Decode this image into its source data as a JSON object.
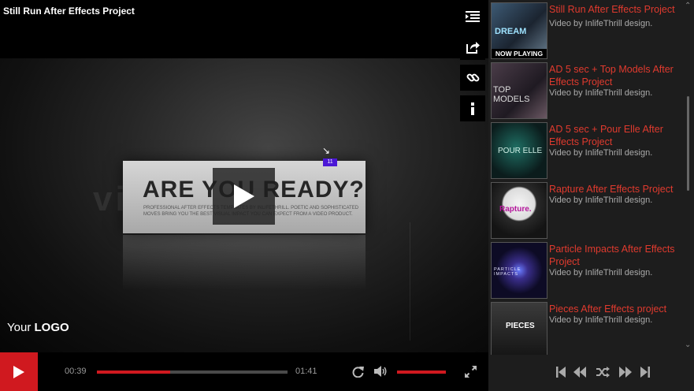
{
  "video": {
    "title": "Still Run After Effects Project",
    "logo_prefix": "Your",
    "logo_bold": "LOGO",
    "scene_heading": "ARE YOU READY?",
    "scene_subtext": "PROFESSIONAL AFTER EFFECTS TEMPLATES BY INLIFETHRILL. POETIC AND SOPHISTICATED MOVES BRING YOU THE BEST VISUAL IMPACT YOU CAN EXPECT FROM A VIDEO PRODUCT.",
    "scene_badge": "11"
  },
  "side_tools": [
    {
      "icon": "playlist-icon"
    },
    {
      "icon": "share-icon"
    },
    {
      "icon": "link-icon"
    },
    {
      "icon": "info-icon"
    }
  ],
  "controls": {
    "current_time": "00:39",
    "duration": "01:41",
    "progress": 0.385,
    "volume": 1.0
  },
  "playlist": {
    "items": [
      {
        "title": "Still Run After Effects Project",
        "author": "Video by InlifeThrill design.",
        "now_playing": "NOW PLAYING",
        "thumb_text": "DREAM"
      },
      {
        "title": "AD 5 sec + Top Models After Effects Project",
        "author": "Video by InlifeThrill design.",
        "thumb_text": "TOP MODELS"
      },
      {
        "title": "AD 5 sec + Pour Elle After Effects Project",
        "author": "Video by InlifeThrill design.",
        "thumb_text": "POUR ELLE"
      },
      {
        "title": "Rapture After Effects Project",
        "author": "Video by InlifeThrill design.",
        "thumb_text": "Rapture."
      },
      {
        "title": "Particle Impacts After Effects Project",
        "author": "Video by InlifeThrill design.",
        "thumb_text": "PARTICLE IMPACTS"
      },
      {
        "title": "Pieces After Effects project",
        "author": "Video by InlifeThrill design.",
        "thumb_text": "PIECES"
      }
    ]
  },
  "colors": {
    "accent": "#d0191f",
    "playlist_title": "#e03a2e",
    "badge": "#4b17d6"
  }
}
